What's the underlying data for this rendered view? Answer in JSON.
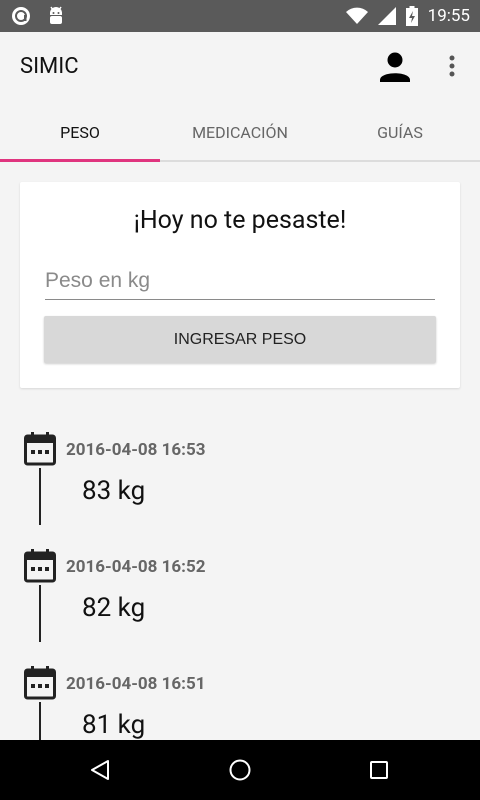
{
  "status_bar": {
    "time": "19:55"
  },
  "app_bar": {
    "title": "SIMIC"
  },
  "tabs": [
    {
      "label": "PESO",
      "active": true
    },
    {
      "label": "MEDICACIÓN",
      "active": false
    },
    {
      "label": "GUÍAS",
      "active": false
    }
  ],
  "card": {
    "title": "¡Hoy no te pesaste!",
    "input_placeholder": "Peso en kg",
    "input_value": "",
    "button_label": "INGRESAR PESO"
  },
  "entries": [
    {
      "date": "2016-04-08 16:53",
      "weight": "83 kg"
    },
    {
      "date": "2016-04-08 16:52",
      "weight": "82 kg"
    },
    {
      "date": "2016-04-08 16:51",
      "weight": "81 kg"
    }
  ],
  "colors": {
    "accent": "#e0357f",
    "status_bar": "#5a5a5a",
    "nav_bar": "#000000"
  }
}
